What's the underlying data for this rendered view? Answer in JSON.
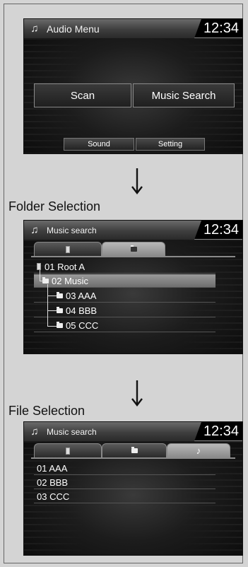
{
  "screens": {
    "audio_menu": {
      "title": "Audio Menu",
      "clock": "12:34",
      "buttons": {
        "scan": "Scan",
        "music_search": "Music Search",
        "sound": "Sound",
        "setting": "Setting"
      }
    },
    "folder_selection": {
      "caption": "Folder Selection",
      "title": "Music search",
      "clock": "12:34",
      "tabs": [
        {
          "icon": "usb-device-icon"
        },
        {
          "icon": "folder-icon",
          "active": true
        }
      ],
      "rows": [
        {
          "label": "01 Root A",
          "icon": "device-icon"
        },
        {
          "label": "02 Music",
          "icon": "folder-icon",
          "selected": true
        },
        {
          "label": "03 AAA",
          "icon": "folder-icon"
        },
        {
          "label": "04 BBB",
          "icon": "folder-icon"
        },
        {
          "label": "05 CCC",
          "icon": "folder-icon"
        }
      ]
    },
    "file_selection": {
      "caption": "File Selection",
      "title": "Music search",
      "clock": "12:34",
      "tabs": [
        {
          "icon": "usb-device-icon"
        },
        {
          "icon": "folder-icon"
        },
        {
          "icon": "music-note-icon",
          "symbol": "♪",
          "active": true
        }
      ],
      "rows": [
        {
          "label": "01 AAA"
        },
        {
          "label": "02 BBB"
        },
        {
          "label": "03 CCC"
        }
      ]
    }
  },
  "colors": {
    "page_bg": "#d4d4d4",
    "screen_bg": "#1c1c1c",
    "highlight": "#8a8a8a"
  }
}
